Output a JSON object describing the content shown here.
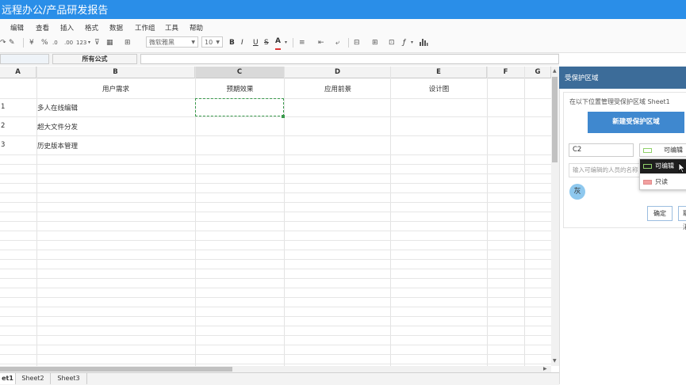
{
  "app": {
    "title": "远程办公/产品研发报告"
  },
  "menu": [
    "编辑",
    "查看",
    "插入",
    "格式",
    "数据",
    "工作组",
    "工具",
    "帮助"
  ],
  "toolbar": {
    "currency": "¥",
    "percent": "%",
    "decrease_decimal": ".0",
    "increase_decimal": ".00",
    "number_format": "123",
    "font_name": "微软雅黑",
    "font_size": "10",
    "bold": "B",
    "italic": "I",
    "underline": "U",
    "strike": "S",
    "font_color": "A",
    "function": "ƒ"
  },
  "formula_bar": {
    "name_box": "",
    "all_formulas": "所有公式",
    "formula": ""
  },
  "grid": {
    "columns": [
      "A",
      "B",
      "C",
      "D",
      "E",
      "F",
      "G"
    ],
    "active_column": "C",
    "header_row": [
      "",
      "用户需求",
      "预期效果",
      "应用前景",
      "设计图"
    ],
    "rows": [
      {
        "num": "1",
        "b": "多人在线编辑"
      },
      {
        "num": "2",
        "b": "超大文件分发"
      },
      {
        "num": "3",
        "b": "历史版本管理"
      }
    ]
  },
  "sheets": [
    "et1",
    "Sheet2",
    "Sheet3"
  ],
  "panel": {
    "title": "受保护区域",
    "description": "在以下位置管理受保护区域 Sheet1",
    "new_button": "新建受保护区域",
    "range": "C2",
    "permission": "可编辑",
    "user_placeholder": "输入可编辑的人员的名称",
    "options": [
      "可编辑",
      "只读"
    ],
    "avatar": "灰",
    "ok": "确定",
    "cancel": "取消"
  },
  "colors": {
    "titlebar": "#2a8ee8",
    "panel_header": "#3c6c99",
    "primary_button": "#3f88cf",
    "editable_swatch": "#8fd16a",
    "readonly_swatch": "#f2a0a0",
    "selection_border": "#3a9a4c"
  },
  "icons": [
    "redo-icon",
    "format-painter-icon",
    "filter-icon",
    "table-icon",
    "border-icon",
    "align-icon",
    "indent-icon",
    "wrap-icon",
    "insert-row-icon",
    "insert-col-icon",
    "merge-icon",
    "function-icon",
    "chart-icon",
    "cursor-icon"
  ]
}
